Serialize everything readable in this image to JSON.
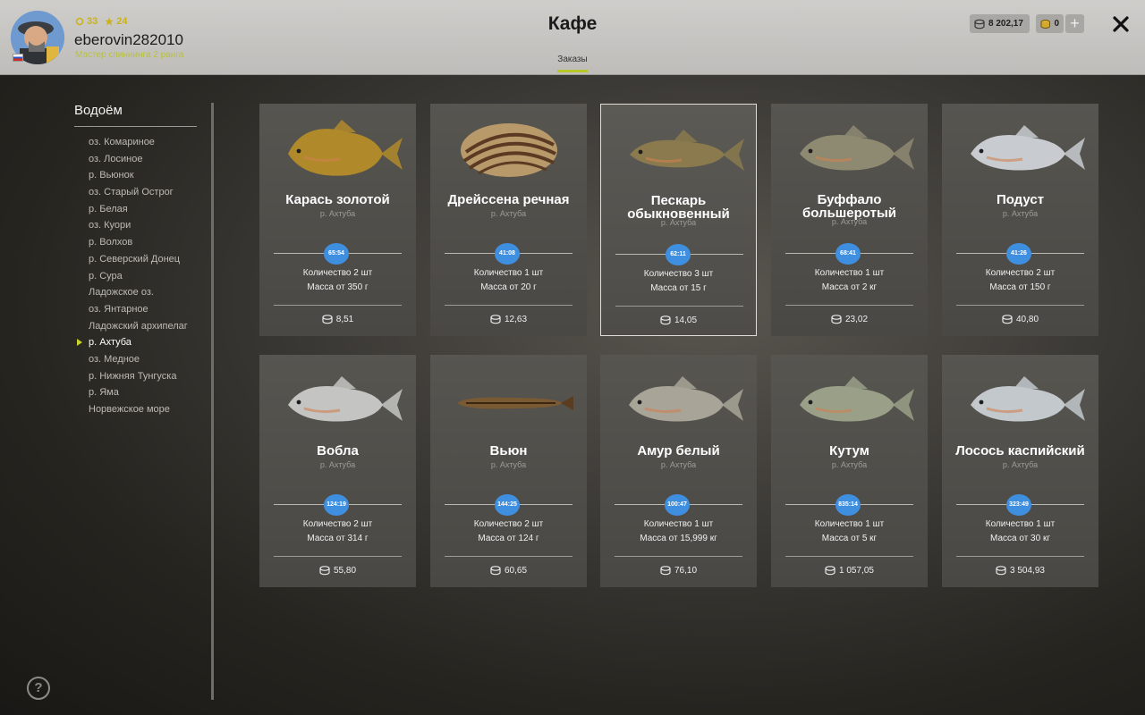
{
  "header": {
    "level": "33",
    "stars": "24",
    "username": "eberovin282010",
    "rank": "Мастер спиннинга 2 ранга",
    "title": "Кафе",
    "tab": "Заказы",
    "silver": "8 202,17",
    "gold": "0",
    "plus": "+",
    "icons": {
      "level": "level-ring-icon",
      "stars": "star-icon",
      "silver": "silver-coins-icon",
      "gold": "gold-coins-icon",
      "close": "close-icon"
    }
  },
  "sidebar": {
    "title": "Водоём",
    "items": [
      "оз. Комариное",
      "оз. Лосиное",
      "р. Вьюнок",
      "оз. Старый Острог",
      "р. Белая",
      "оз. Куори",
      "р. Волхов",
      "р. Северский Донец",
      "р. Сура",
      "Ладожское оз.",
      "оз. Янтарное",
      "Ладожский архипелаг",
      "р. Ахтуба",
      "оз. Медное",
      "р. Нижняя Тунгуска",
      "р. Яма",
      "Норвежское море"
    ],
    "active_index": 12
  },
  "help": "?",
  "orders": [
    {
      "name": "Карась золотой",
      "location": "р. Ахтуба",
      "timer": "65:54",
      "quantity": "Количество 2 шт",
      "mass": "Масса от 350 г",
      "price": "8,51",
      "icon": "crucian-carp-icon",
      "color": "#b08a2a"
    },
    {
      "name": "Дрейссена речная",
      "location": "р. Ахтуба",
      "timer": "41:08",
      "quantity": "Количество 1 шт",
      "mass": "Масса от 20 г",
      "price": "12,63",
      "icon": "zebra-mussel-icon",
      "color": "#b89a6a"
    },
    {
      "name": "Пескарь обыкновенный",
      "location": "р. Ахтуба",
      "timer": "62:11",
      "quantity": "Количество 3 шт",
      "mass": "Масса от 15 г",
      "price": "14,05",
      "icon": "gudgeon-icon",
      "color": "#8a7a4e"
    },
    {
      "name": "Буффало большеротый",
      "location": "р. Ахтуба",
      "timer": "68:41",
      "quantity": "Количество 1 шт",
      "mass": "Масса от 2 кг",
      "price": "23,02",
      "icon": "bigmouth-buffalo-icon",
      "color": "#8e8a72"
    },
    {
      "name": "Подуст",
      "location": "р. Ахтуба",
      "timer": "41:26",
      "quantity": "Количество 2 шт",
      "mass": "Масса от 150 г",
      "price": "40,80",
      "icon": "nase-icon",
      "color": "#c8ccd0"
    },
    {
      "name": "Вобла",
      "location": "р. Ахтуба",
      "timer": "124:19",
      "quantity": "Количество 2 шт",
      "mass": "Масса от 314 г",
      "price": "55,80",
      "icon": "caspian-roach-icon",
      "color": "#c4c4c2"
    },
    {
      "name": "Вьюн",
      "location": "р. Ахтуба",
      "timer": "144:25",
      "quantity": "Количество 2 шт",
      "mass": "Масса от 124 г",
      "price": "60,65",
      "icon": "weatherfish-icon",
      "color": "#7a5a32"
    },
    {
      "name": "Амур белый",
      "location": "р. Ахтуба",
      "timer": "100:47",
      "quantity": "Количество 1 шт",
      "mass": "Масса от 15,999 кг",
      "price": "76,10",
      "icon": "grass-carp-icon",
      "color": "#a8a498"
    },
    {
      "name": "Кутум",
      "location": "р. Ахтуба",
      "timer": "835:14",
      "quantity": "Количество 1 шт",
      "mass": "Масса от 5 кг",
      "price": "1 057,05",
      "icon": "caspian-kutum-icon",
      "color": "#9aa088"
    },
    {
      "name": "Лосось каспийский",
      "location": "р. Ахтуба",
      "timer": "323:49",
      "quantity": "Количество 1 шт",
      "mass": "Масса от 30 кг",
      "price": "3 504,93",
      "icon": "caspian-salmon-icon",
      "color": "#c2c8cc"
    }
  ],
  "selected_index": 2
}
